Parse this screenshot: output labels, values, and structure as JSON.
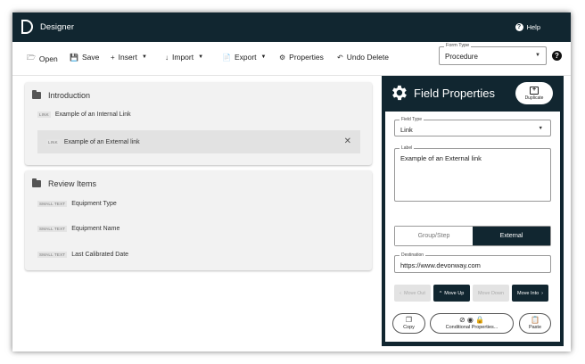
{
  "app": {
    "title": "Designer",
    "help_label": "Help"
  },
  "toolbar": {
    "open": "Open",
    "save": "Save",
    "insert": "Insert",
    "import": "Import",
    "export": "Export",
    "properties": "Properties",
    "undo_delete": "Undo Delete",
    "form_type_label": "Form Type",
    "form_type_value": "Procedure"
  },
  "sections": [
    {
      "title": "Introduction",
      "items": [
        {
          "tag": "LINK",
          "label": "Example of an Internal Link"
        },
        {
          "tag": "LINK",
          "label": "Example of an External link"
        }
      ]
    },
    {
      "title": "Review Items",
      "items": [
        {
          "tag": "SMALL TEXT",
          "label": "Equipment Type"
        },
        {
          "tag": "SMALL TEXT",
          "label": "Equipment Name"
        },
        {
          "tag": "SMALL TEXT",
          "label": "Last Calibrated Date"
        }
      ]
    }
  ],
  "panel": {
    "title": "Field Properties",
    "duplicate": "Duplicate",
    "field_type_label": "Field Type",
    "field_type_value": "Link",
    "label_label": "Label",
    "label_value": "Example of an External link",
    "link_kind_options": [
      "Group/Step",
      "External"
    ],
    "link_kind_selected": "External",
    "destination_label": "Destination",
    "destination_value": "https://www.devonway.com",
    "move_out": "Move Out",
    "move_up": "Move Up",
    "move_down": "Move Down",
    "move_into": "Move Into",
    "copy": "Copy",
    "conditional": "Conditional Properties...",
    "paste": "Paste"
  },
  "colors": {
    "navy": "#112630",
    "panel_bg": "#f2f2f2",
    "selected_row": "#e2e2e2"
  }
}
